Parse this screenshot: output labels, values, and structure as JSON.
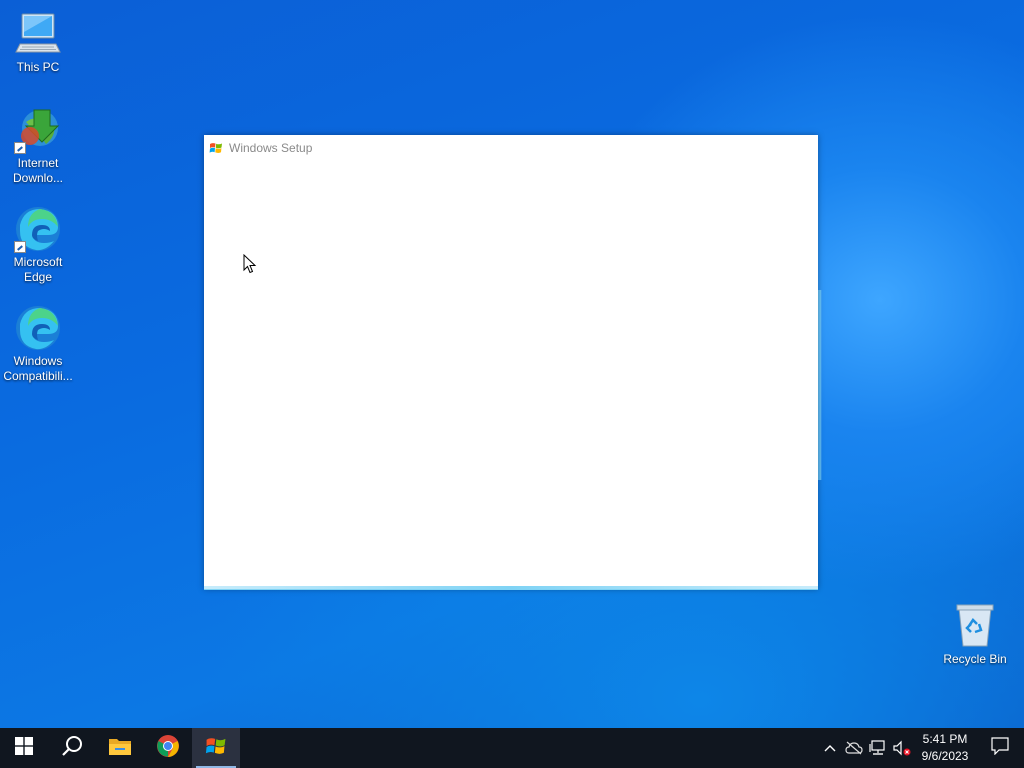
{
  "desktop": {
    "icons": [
      {
        "label": "This PC"
      },
      {
        "label": "Internet Downlo..."
      },
      {
        "label": "Microsoft Edge"
      },
      {
        "label": "Windows Compatibili..."
      },
      {
        "label": "Recycle Bin"
      }
    ]
  },
  "setup_window": {
    "title": "Windows Setup",
    "icon": "windows-flag-icon"
  },
  "taskbar": {
    "buttons": [
      {
        "name": "start-button",
        "icon": "windows-logo-icon"
      },
      {
        "name": "search-button",
        "icon": "search-icon"
      },
      {
        "name": "file-explorer-button",
        "icon": "folder-icon"
      },
      {
        "name": "chrome-button",
        "icon": "chrome-icon"
      },
      {
        "name": "windows-setup-button",
        "icon": "windows-flag-icon",
        "active": true
      }
    ],
    "tray": {
      "icons": [
        "chevron-up-icon",
        "cloud-offline-icon",
        "network-icon",
        "volume-muted-icon"
      ],
      "time": "5:41 PM",
      "date": "9/6/2023"
    }
  },
  "colors": {
    "desktop_accent": "#0a6be0",
    "taskbar": "#10161f",
    "window_glow": "#7fd3f5"
  }
}
